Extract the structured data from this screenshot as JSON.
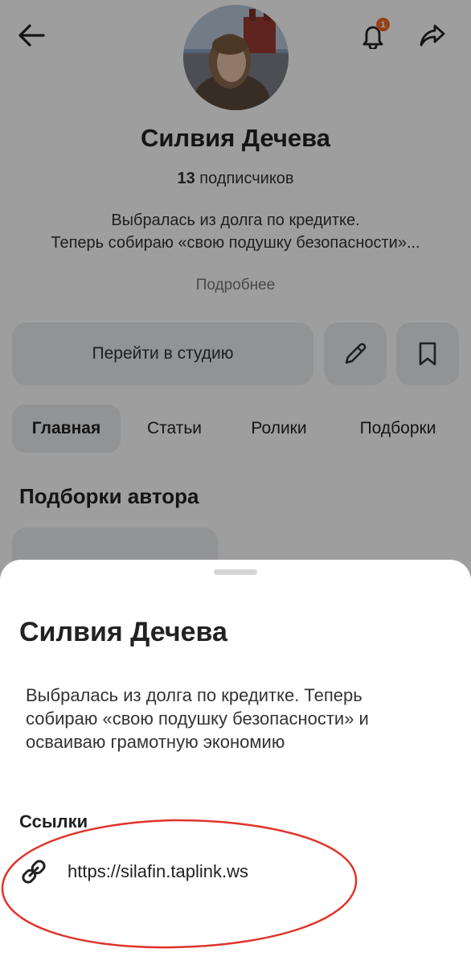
{
  "profile": {
    "name": "Силвия Дечева",
    "subscribers_count": "13",
    "subscribers_label": "подписчиков",
    "bio_line1": "Выбралась из долга по кредитке.",
    "bio_line2": "Теперь собираю «свою подушку безопасности»...",
    "more_label": "Подробнее",
    "notification_badge": "1"
  },
  "actions": {
    "studio_label": "Перейти в студию"
  },
  "tabs": [
    {
      "label": "Главная",
      "active": true
    },
    {
      "label": "Статьи",
      "active": false
    },
    {
      "label": "Ролики",
      "active": false
    },
    {
      "label": "Подборки",
      "active": false
    }
  ],
  "section": {
    "title": "Подборки автора"
  },
  "sheet": {
    "title": "Силвия Дечева",
    "description": "Выбралась из долга по кредитке. Теперь собираю «свою подушку безопасности» и осваиваю грамотную экономию",
    "links_heading": "Ссылки",
    "link_url": "https://silafin.taplink.ws"
  },
  "icons": {
    "back": "arrow-left-icon",
    "bell": "bell-icon",
    "share": "share-icon",
    "edit": "pencil-icon",
    "bookmark": "bookmark-icon",
    "link": "link-icon"
  },
  "colors": {
    "badge": "#f06a2a",
    "button_bg": "#eceef0",
    "annotation": "#e0342a"
  }
}
